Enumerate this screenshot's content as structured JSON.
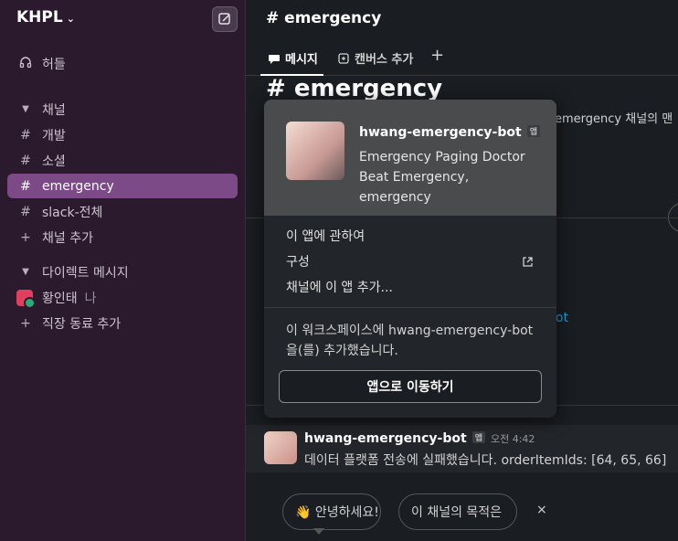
{
  "workspace": {
    "name": "KHPL"
  },
  "sidebar": {
    "huddles": "허들",
    "channels_header": "채널",
    "channels": [
      {
        "name": "개발"
      },
      {
        "name": "소셜"
      },
      {
        "name": "emergency",
        "active": true
      },
      {
        "name": "slack-전체"
      }
    ],
    "add_channel": "채널 추가",
    "dm_header": "다이렉트 메시지",
    "dms": [
      {
        "name": "황인태",
        "suffix": "나"
      }
    ],
    "add_coworker": "직장 동료 추가"
  },
  "channel": {
    "header_title": "# emergency",
    "big_title": "# emergency",
    "intro_fragment": "emergency 채널의 맨",
    "bot_fragment": "bot"
  },
  "tabs": {
    "messages": "메시지",
    "canvas": "캔버스 추가",
    "add": "+"
  },
  "popup": {
    "bot_name": "hwang-emergency-bot",
    "badge": "앱",
    "description": "Emergency Paging Doctor Beat Emergency, emergency",
    "menu": {
      "about": "이 앱에 관하여",
      "configure": "구성",
      "add_to_channel": "채널에 이 앱 추가..."
    },
    "note": "이 워크스페이스에 hwang-emergency-bot 을(를) 추가했습니다.",
    "go_button": "앱으로 이동하기"
  },
  "message": {
    "author": "hwang-emergency-bot",
    "badge": "앱",
    "time": "오전 4:42",
    "text": "데이터 플랫폼 전송에 실패했습니다. orderItemIds: [64, 65, 66]"
  },
  "suggestions": {
    "chip1": "👋 안녕하세요!",
    "chip2": "이 채널의 목적은",
    "close": "×"
  },
  "colors": {
    "sidebar_bg": "#2b1a2e",
    "active_channel": "#7b4a87",
    "link": "#1d9bd1"
  }
}
